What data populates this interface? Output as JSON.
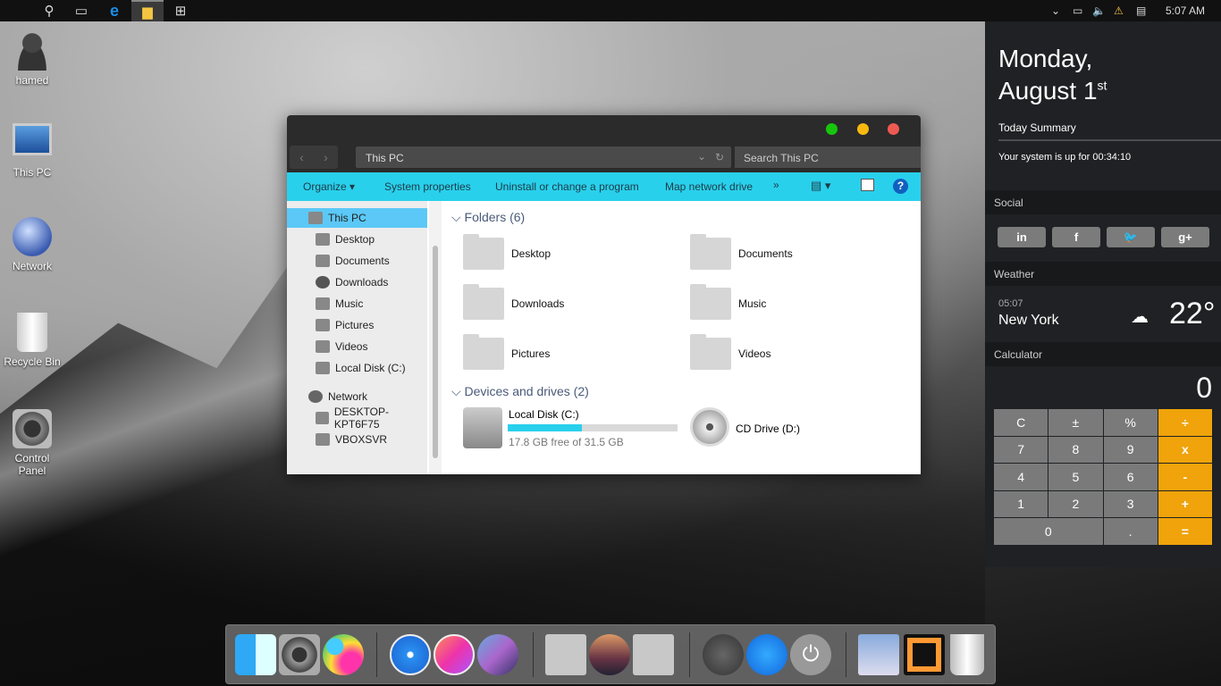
{
  "taskbar": {
    "icons": [
      "apple-icon",
      "search-icon",
      "task-view-icon",
      "edge-icon",
      "file-explorer-icon",
      "store-icon"
    ],
    "tray": [
      "chevron-up-icon",
      "battery-icon",
      "volume-icon",
      "network-warning-icon",
      "notifications-icon"
    ],
    "clock": "5:07 AM"
  },
  "desktop": {
    "icons": [
      {
        "label": "hamed"
      },
      {
        "label": "This PC"
      },
      {
        "label": "Network"
      },
      {
        "label": "Recycle Bin"
      },
      {
        "label": "Control Panel"
      }
    ]
  },
  "explorer": {
    "address": "This PC",
    "search_placeholder": "Search This PC",
    "toolbar": {
      "organize": "Organize ▾",
      "system_properties": "System properties",
      "uninstall": "Uninstall or change a program",
      "map_drive": "Map network drive",
      "more": "»"
    },
    "sidebar": [
      {
        "label": "This PC"
      },
      {
        "label": "Desktop"
      },
      {
        "label": "Documents"
      },
      {
        "label": "Downloads"
      },
      {
        "label": "Music"
      },
      {
        "label": "Pictures"
      },
      {
        "label": "Videos"
      },
      {
        "label": "Local Disk (C:)"
      },
      {
        "label": "Network"
      },
      {
        "label": "DESKTOP-KPT6F75"
      },
      {
        "label": "VBOXSVR"
      }
    ],
    "folders_header": "Folders (6)",
    "folders": [
      "Desktop",
      "Documents",
      "Downloads",
      "Music",
      "Pictures",
      "Videos"
    ],
    "drives_header": "Devices and drives (2)",
    "drives": [
      {
        "name": "Local Disk (C:)",
        "free": "17.8 GB free of 31.5 GB",
        "used_fraction": 0.435
      },
      {
        "name": "CD Drive (D:)"
      }
    ]
  },
  "panel": {
    "day": "Monday,",
    "date": "August 1",
    "date_suffix": "st",
    "summary_title": "Today Summary",
    "uptime": "Your system is up for 00:34:10",
    "social_title": "Social",
    "social": [
      "in",
      "f",
      "🐦",
      "g+"
    ],
    "weather_title": "Weather",
    "weather_time": "05:07",
    "city": "New York",
    "temp": "22°",
    "calc_title": "Calculator",
    "display": "0",
    "keys": [
      "C",
      "±",
      "%",
      "÷",
      "7",
      "8",
      "9",
      "x",
      "4",
      "5",
      "6",
      "-",
      "1",
      "2",
      "3",
      "+",
      "0",
      ".",
      "="
    ]
  },
  "dock": {
    "apps": [
      "finder",
      "system-preferences",
      "game-center",
      "safari",
      "itunes",
      "siri",
      "folder",
      "macos-sierra",
      "applications-folder",
      "launchpad",
      "app-store",
      "power",
      "preview",
      "mission-control",
      "trash"
    ]
  },
  "colors": {
    "accent": "#29d0ec",
    "orange": "#f0a30a"
  }
}
